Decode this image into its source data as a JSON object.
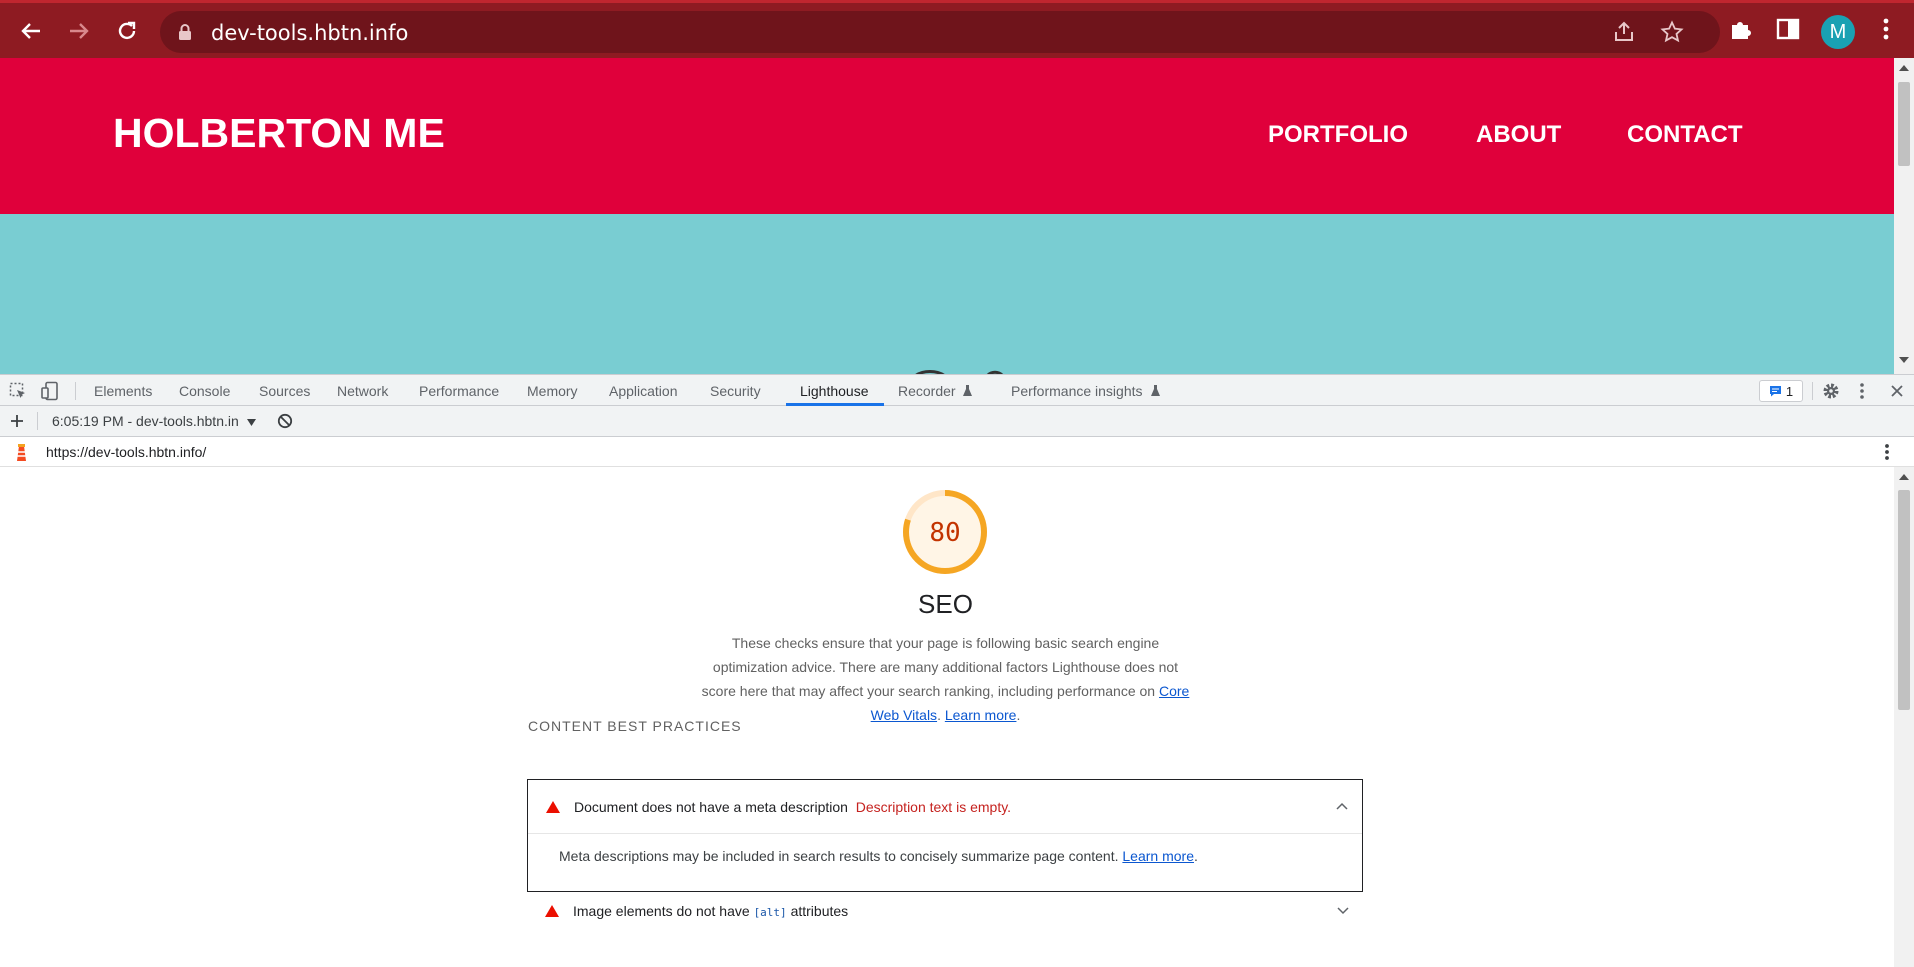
{
  "browser": {
    "url": "dev-tools.hbtn.info",
    "avatar_letter": "M",
    "frame_color": "#8e1b22"
  },
  "site": {
    "title": "HOLBERTON ME",
    "nav": [
      "PORTFOLIO",
      "ABOUT",
      "CONTACT"
    ],
    "header_color": "#e0003b",
    "hero_color": "#79cdd2"
  },
  "devtools": {
    "tabs": [
      "Elements",
      "Console",
      "Sources",
      "Network",
      "Performance",
      "Memory",
      "Application",
      "Security",
      "Lighthouse",
      "Recorder",
      "Performance insights"
    ],
    "active_tab": "Lighthouse",
    "issues_count": "1",
    "report_select": "6:05:19 PM - dev-tools.hbtn.in",
    "report_url": "https://dev-tools.hbtn.info/"
  },
  "report": {
    "score": "80",
    "score_fraction": 0.8,
    "category_title": "SEO",
    "description_1": "These checks ensure that your page is following basic search engine optimization advice. There are many additional factors Lighthouse does not score here that may affect your search ranking, including performance on ",
    "link_core_web_vitals": "Core Web Vitals",
    "description_sep": ". ",
    "link_learn_more": "Learn more",
    "description_end": ".",
    "group_title": "CONTENT BEST PRACTICES",
    "audits": [
      {
        "title": "Document does not have a meta description",
        "error": "Description text is empty.",
        "description": "Meta descriptions may be included in search results to concisely summarize page content. ",
        "link": "Learn more",
        "end": "."
      },
      {
        "title_pre": "Image elements do not have ",
        "code": "[alt]",
        "title_post": " attributes"
      }
    ]
  }
}
